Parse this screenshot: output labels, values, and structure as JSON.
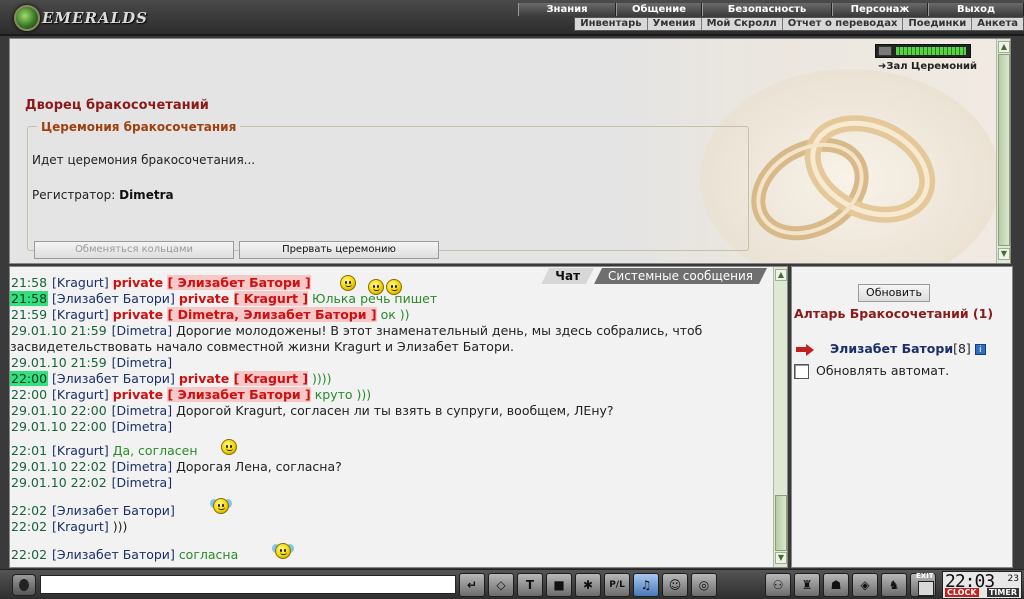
{
  "header": {
    "logo_text": "EMERALDS",
    "menu_top": [
      "Знания",
      "Общение",
      "Безопасность",
      "Персонаж",
      "Выход"
    ],
    "menu_bottom": [
      "Инвентарь",
      "Умения",
      "Мой Скролл",
      "Отчет о переводах",
      "Поединки",
      "Анкета"
    ]
  },
  "room": {
    "link_label": "Зал Церемоний",
    "title": "Дворец бракосочетаний",
    "ceremony_legend": "Церемония бракосочетания",
    "status": "Идет церемония бракосочетания...",
    "registrar_label": "Регистратор:",
    "registrar_name": "Dimetra",
    "btn_exchange": "Обменяться кольцами",
    "btn_stop": "Прервать церемонию"
  },
  "chat": {
    "tabs": [
      "Чат",
      "Системные сообщения"
    ],
    "lines": [
      {
        "time": "21:58",
        "hl": false,
        "name": "Kragurt",
        "private": "Элизабет Батори",
        "msg": ""
      },
      {
        "time": "21:58",
        "hl": true,
        "name": "Элизабет Батори",
        "private": "Kragurt",
        "msg": "Юлька речь пишет"
      },
      {
        "time": "21:59",
        "hl": false,
        "name": "Kragurt",
        "private": "Dimetra, Элизабет Батори",
        "msg": "ок ))"
      },
      {
        "time": "29.01.10 21:59",
        "hl": false,
        "name": "Dimetra",
        "private": "",
        "msg": "Дорогие молодожены! В этот знаменательный день, мы здесь собрались, чтоб"
      },
      {
        "time": "",
        "hl": false,
        "name": "",
        "private": "",
        "msg": "засвидетельствовать начало совместной жизни Kragurt и Элизабет Батори."
      },
      {
        "time": "29.01.10 21:59",
        "hl": false,
        "name": "Dimetra",
        "private": "",
        "msg": ""
      },
      {
        "time": "22:00",
        "hl": true,
        "name": "Элизабет Батори",
        "private": "Kragurt",
        "msg": "))))"
      },
      {
        "time": "22:00",
        "hl": false,
        "name": "Kragurt",
        "private": "Элизабет Батори",
        "msg": "круто )))"
      },
      {
        "time": "29.01.10 22:00",
        "hl": false,
        "name": "Dimetra",
        "private": "",
        "msg": "Дорогой Kragurt, согласен ли ты взять в супруги, вообщем, ЛЕну?"
      },
      {
        "time": "29.01.10 22:00",
        "hl": false,
        "name": "Dimetra",
        "private": "",
        "msg": ""
      },
      {
        "time": "22:01",
        "hl": false,
        "name": "Kragurt",
        "private": "",
        "msg": "Да, согласен"
      },
      {
        "time": "29.01.10 22:02",
        "hl": false,
        "name": "Dimetra",
        "private": "",
        "msg": "Дорогая Лена, согласна?"
      },
      {
        "time": "29.01.10 22:02",
        "hl": false,
        "name": "Dimetra",
        "private": "",
        "msg": ""
      },
      {
        "time": "22:02",
        "hl": false,
        "name": "Элизабет Батори",
        "private": "",
        "msg": ""
      },
      {
        "time": "22:02",
        "hl": false,
        "name": "Kragurt",
        "private": "",
        "msg": ")))"
      },
      {
        "time": "22:02",
        "hl": false,
        "name": "Элизабет Батори",
        "private": "",
        "msg": "согласна"
      }
    ],
    "private_word": "private",
    "input_value": ""
  },
  "altar": {
    "refresh_label": "Обновить",
    "title": "Алтарь Бракосочетаний (1)",
    "user_name": "Элизабет Батори",
    "user_level": "[8]",
    "info_glyph": "i",
    "auto_label": "Обновлять автомат."
  },
  "bottombar": {
    "tool_labels": [
      "↵",
      "◇",
      "T",
      "■",
      "✱",
      "P/L",
      "♫",
      "☺",
      "◎",
      "⚇",
      "♜",
      "☗",
      "◈",
      "♞",
      "▣"
    ],
    "exit_label": "EXIT",
    "clock_time": "22:03",
    "clock_sec": "23",
    "clock_label": "CLOCK",
    "timer_label": "TIMER"
  },
  "colors": {
    "title_red": "#8b1a1a",
    "private_red": "#d01010",
    "time_green": "#17633a",
    "highlight": "#33e080",
    "name_blue": "#1a2e6a"
  }
}
